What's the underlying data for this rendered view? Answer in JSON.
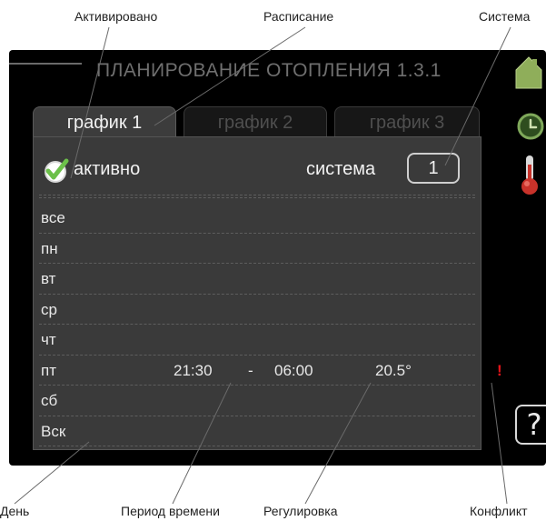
{
  "annotations": {
    "activated": "Активировано",
    "schedule": "Расписание",
    "system": "Система",
    "day": "День",
    "time_period": "Период времени",
    "adjustment": "Регулировка",
    "conflict": "Конфликт"
  },
  "screen": {
    "title": "ПЛАНИРОВАНИЕ ОТОПЛЕНИЯ 1.3.1",
    "tabs": [
      {
        "label": "график 1",
        "active": true
      },
      {
        "label": "график 2",
        "active": false
      },
      {
        "label": "график 3",
        "active": false
      }
    ],
    "active_label": "активно",
    "active_checked": true,
    "system_label": "система",
    "system_value": "1",
    "days": [
      {
        "label": "все",
        "start": "",
        "dash": "",
        "end": "",
        "temp": "",
        "conflict": ""
      },
      {
        "label": "пн",
        "start": "",
        "dash": "",
        "end": "",
        "temp": "",
        "conflict": ""
      },
      {
        "label": "вт",
        "start": "",
        "dash": "",
        "end": "",
        "temp": "",
        "conflict": ""
      },
      {
        "label": "ср",
        "start": "",
        "dash": "",
        "end": "",
        "temp": "",
        "conflict": ""
      },
      {
        "label": "чт",
        "start": "",
        "dash": "",
        "end": "",
        "temp": "",
        "conflict": ""
      },
      {
        "label": "пт",
        "start": "21:30",
        "dash": "-",
        "end": "06:00",
        "temp": "20.5°",
        "conflict": "!"
      },
      {
        "label": "сб",
        "start": "",
        "dash": "",
        "end": "",
        "temp": "",
        "conflict": ""
      },
      {
        "label": "Вск",
        "start": "",
        "dash": "",
        "end": "",
        "temp": "",
        "conflict": ""
      }
    ],
    "help_label": "?",
    "icons": [
      "house-icon",
      "clock-icon",
      "thermometer-icon",
      "help-icon",
      "check-icon"
    ],
    "colors": {
      "check_green": "#6cc04a",
      "conflict_red": "#e8141a",
      "house_green": "#8fae5a"
    }
  }
}
